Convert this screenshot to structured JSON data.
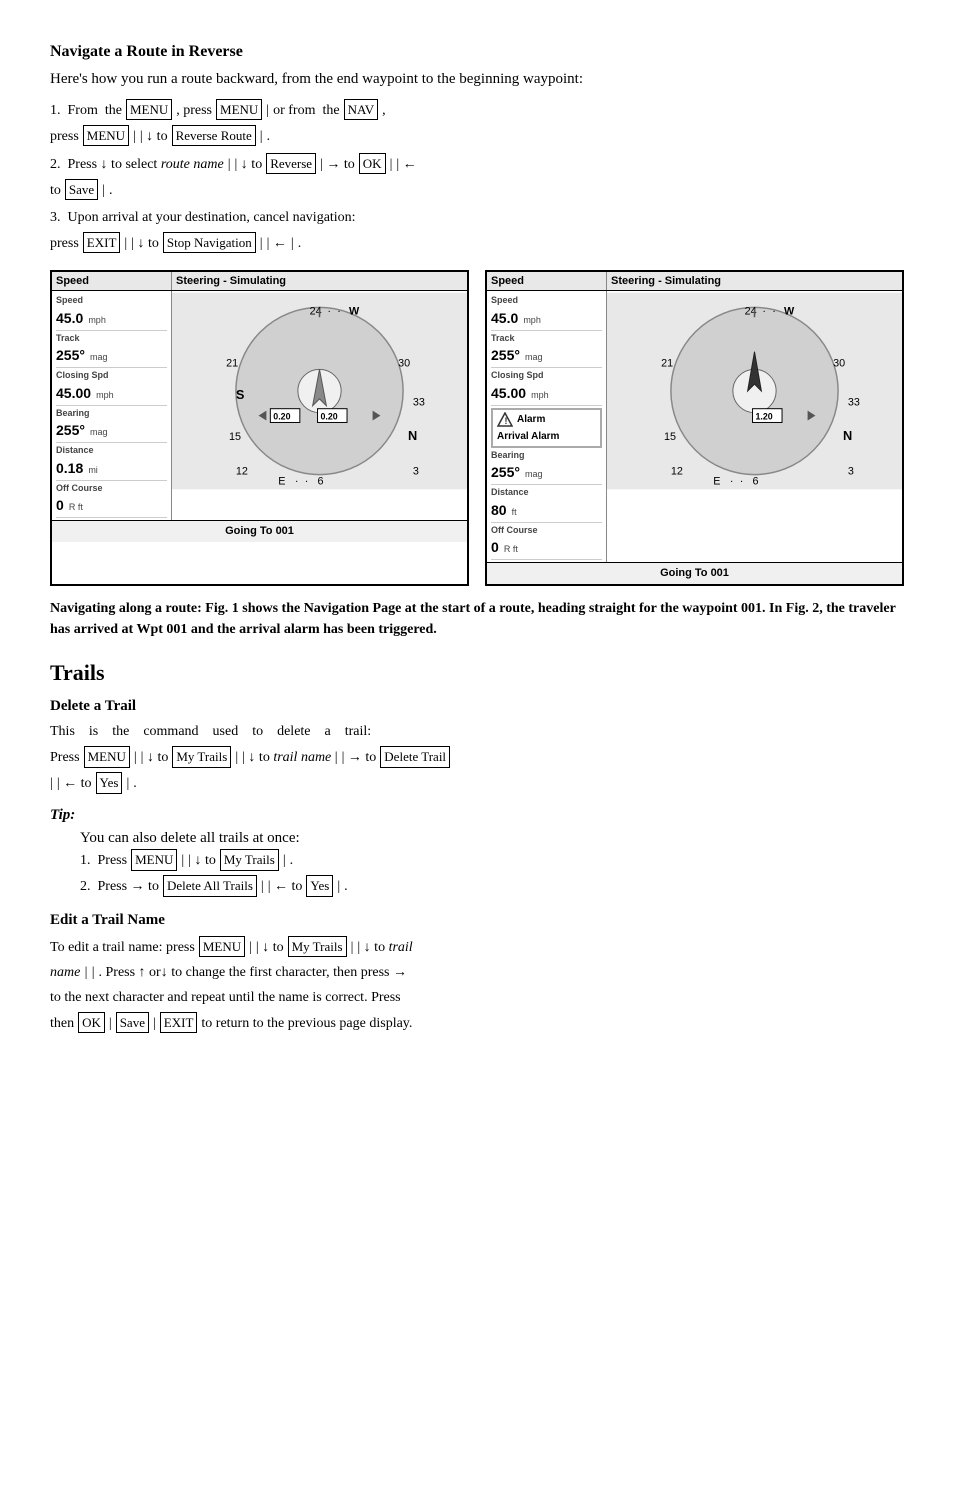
{
  "page": {
    "navigate_route_reverse": {
      "title": "Navigate a Route in Reverse",
      "intro": "Here's how you run a route backward, from the end waypoint to the beginning waypoint:",
      "step1_prefix": "1.  From  the",
      "step1_press": ", press",
      "step1_or": "or from  the",
      "step1_comma": ",",
      "step1_line2_press": "press",
      "step1_line2_down_to": "| ↓ to",
      "step1_line2_pipe": "|",
      "step1_line2_dot": ".",
      "step2_prefix": "2.  Press ↓ to select",
      "step2_route_name": "route name",
      "step2_pipe1": "|",
      "step2_down_to": "| ↓ to",
      "step2_right_to": "| → to",
      "step2_pipe2": "|",
      "step2_left": "| ←",
      "step2_to": "to",
      "step2_pipe3": "|",
      "step2_dot": ".",
      "step3_prefix": "3.  Upon arrival at your destination, cancel navigation:",
      "step3_line2_press": "press",
      "step3_line2_pipe1": "|",
      "step3_line2_down_to": "| ↓ to",
      "step3_line2_pipe2": "|",
      "step3_line2_left": "| ←",
      "step3_line2_pipe3": "|",
      "step3_line2_dot": "."
    },
    "figures": {
      "fig1": {
        "header_left": "Speed",
        "header_right": "Steering - Simulating",
        "speed_val": "45.0",
        "speed_unit": "mph",
        "track_label": "Track",
        "track_val": "255°",
        "track_unit": "mag",
        "closing_label": "Closing Spd",
        "closing_val": "45.00",
        "closing_unit": "mph",
        "bearing_label": "Bearing",
        "bearing_val": "255°",
        "bearing_unit": "mag",
        "distance_label": "Distance",
        "distance_val": "0.18",
        "distance_unit": "mi",
        "offcourse_label": "Off Course",
        "offcourse_val": "0",
        "offcourse_unit": "R ft",
        "footer": "Going To 001",
        "compass_nums": [
          "24",
          "W",
          "21",
          "30",
          "S",
          "33",
          "15",
          "N",
          "12",
          "3",
          "E",
          "6"
        ],
        "scale_left": "0.20",
        "scale_right": "0.20"
      },
      "fig2": {
        "header_left": "Speed",
        "header_right": "Steering - Simulating",
        "speed_val": "45.0",
        "speed_unit": "mph",
        "track_label": "Track",
        "track_val": "255°",
        "track_unit": "mag",
        "closing_label": "Closing Spd",
        "closing_val": "45.00",
        "closing_unit": "mph",
        "bearing_label": "Bearing",
        "bearing_val": "255°",
        "bearing_unit": "mag",
        "distance_label": "Distance",
        "distance_val": "80",
        "distance_unit": "ft",
        "offcourse_label": "Off Course",
        "offcourse_val": "0",
        "offcourse_unit": "R ft",
        "footer": "Going To 001",
        "alarm_label": "Alarm",
        "alarm_text": "Arrival Alarm"
      }
    },
    "caption": "Navigating along a route: Fig. 1 shows the Navigation Page at the start of a route, heading straight for the waypoint 001. In Fig. 2, the traveler has arrived at Wpt 001 and the arrival alarm has been triggered.",
    "trails": {
      "title": "Trails",
      "delete_title": "Delete a Trail",
      "delete_intro_parts": [
        "This",
        "is",
        "the",
        "command",
        "used",
        "to",
        "delete",
        "a",
        "trail:"
      ],
      "delete_line1": "Press",
      "delete_line1_down_to": "| ↓ to",
      "delete_line1_pipe": "|",
      "delete_line1_down_trail": "| ↓ to  trail name |",
      "delete_line1_right_to": "| → to",
      "delete_line2_pipe1": "|",
      "delete_line2_left_to": "| ← to",
      "delete_line2_pipe2": "|",
      "delete_line2_dot": ".",
      "tip_label": "Tip:",
      "tip_text": "You can also delete all trails at once:",
      "tip_step1": "1.  Press",
      "tip_step1_pipe": "|",
      "tip_step1_down_to": "| ↓ to",
      "tip_step1_pipe2": "|",
      "tip_step1_dot": ".",
      "tip_step2": "2.  Press → to",
      "tip_step2_pipe": "|",
      "tip_step2_left_to": "| ← to",
      "tip_step2_pipe2": "|",
      "tip_step2_dot": ".",
      "edit_title": "Edit a Trail Name",
      "edit_line1": "To edit a trail name: press",
      "edit_line1_pipe": "|",
      "edit_line1_down_to": "| ↓ to",
      "edit_line1_pipe2": "|",
      "edit_line1_down_trail": "| ↓ to  trail",
      "edit_line2_name": "name |",
      "edit_line2_pipe": "|",
      "edit_line2_press_up_or_down": ". Press ↑ or↓ to change the first character, then press →",
      "edit_line3": "to the next character and repeat until the name is correct. Press",
      "edit_line4_then": "then",
      "edit_line4_pipes": "| | |",
      "edit_line4_return": "to return to the previous page display."
    }
  }
}
